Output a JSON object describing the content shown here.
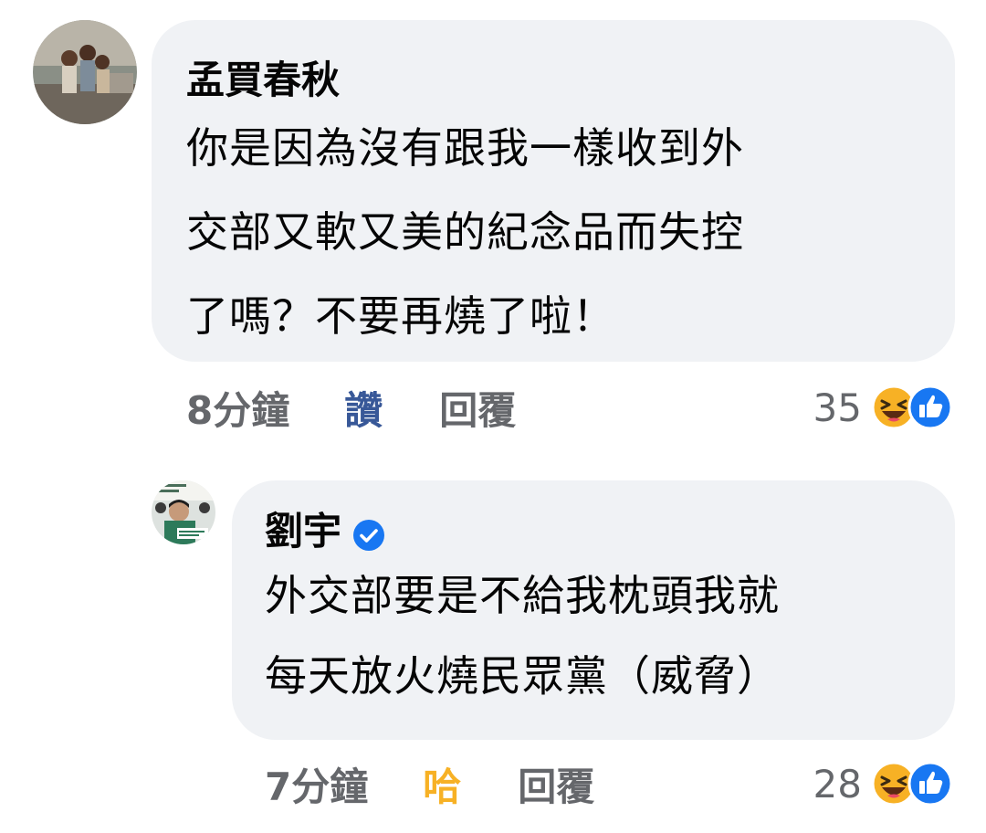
{
  "comments": [
    {
      "author": "孟買春秋",
      "verified": false,
      "text_lines": [
        "你是因為沒有跟我一樣收到外",
        "交部又軟又美的紀念品而失控",
        "了嗎？不要再燒了啦！"
      ],
      "time": "8分鐘",
      "reaction_label": "讚",
      "reaction_color": "#385898",
      "reply_label": "回覆",
      "reaction_count": "35",
      "reaction_icons": [
        "haha-icon",
        "like-icon"
      ]
    },
    {
      "author": "劉宇",
      "verified": true,
      "text_lines": [
        "外交部要是不給我枕頭我就",
        "每天放火燒民眾黨（威脅）"
      ],
      "time": "7分鐘",
      "reaction_label": "哈",
      "reaction_color": "#f7b125",
      "reply_label": "回覆",
      "reaction_count": "28",
      "reaction_icons": [
        "haha-icon",
        "like-icon"
      ]
    }
  ],
  "colors": {
    "bubble_bg": "#f0f2f5",
    "text": "#050505",
    "meta": "#65676b",
    "like_blue": "#1877f2",
    "haha_yellow": "#f7b125",
    "verified_blue": "#1877f2"
  }
}
